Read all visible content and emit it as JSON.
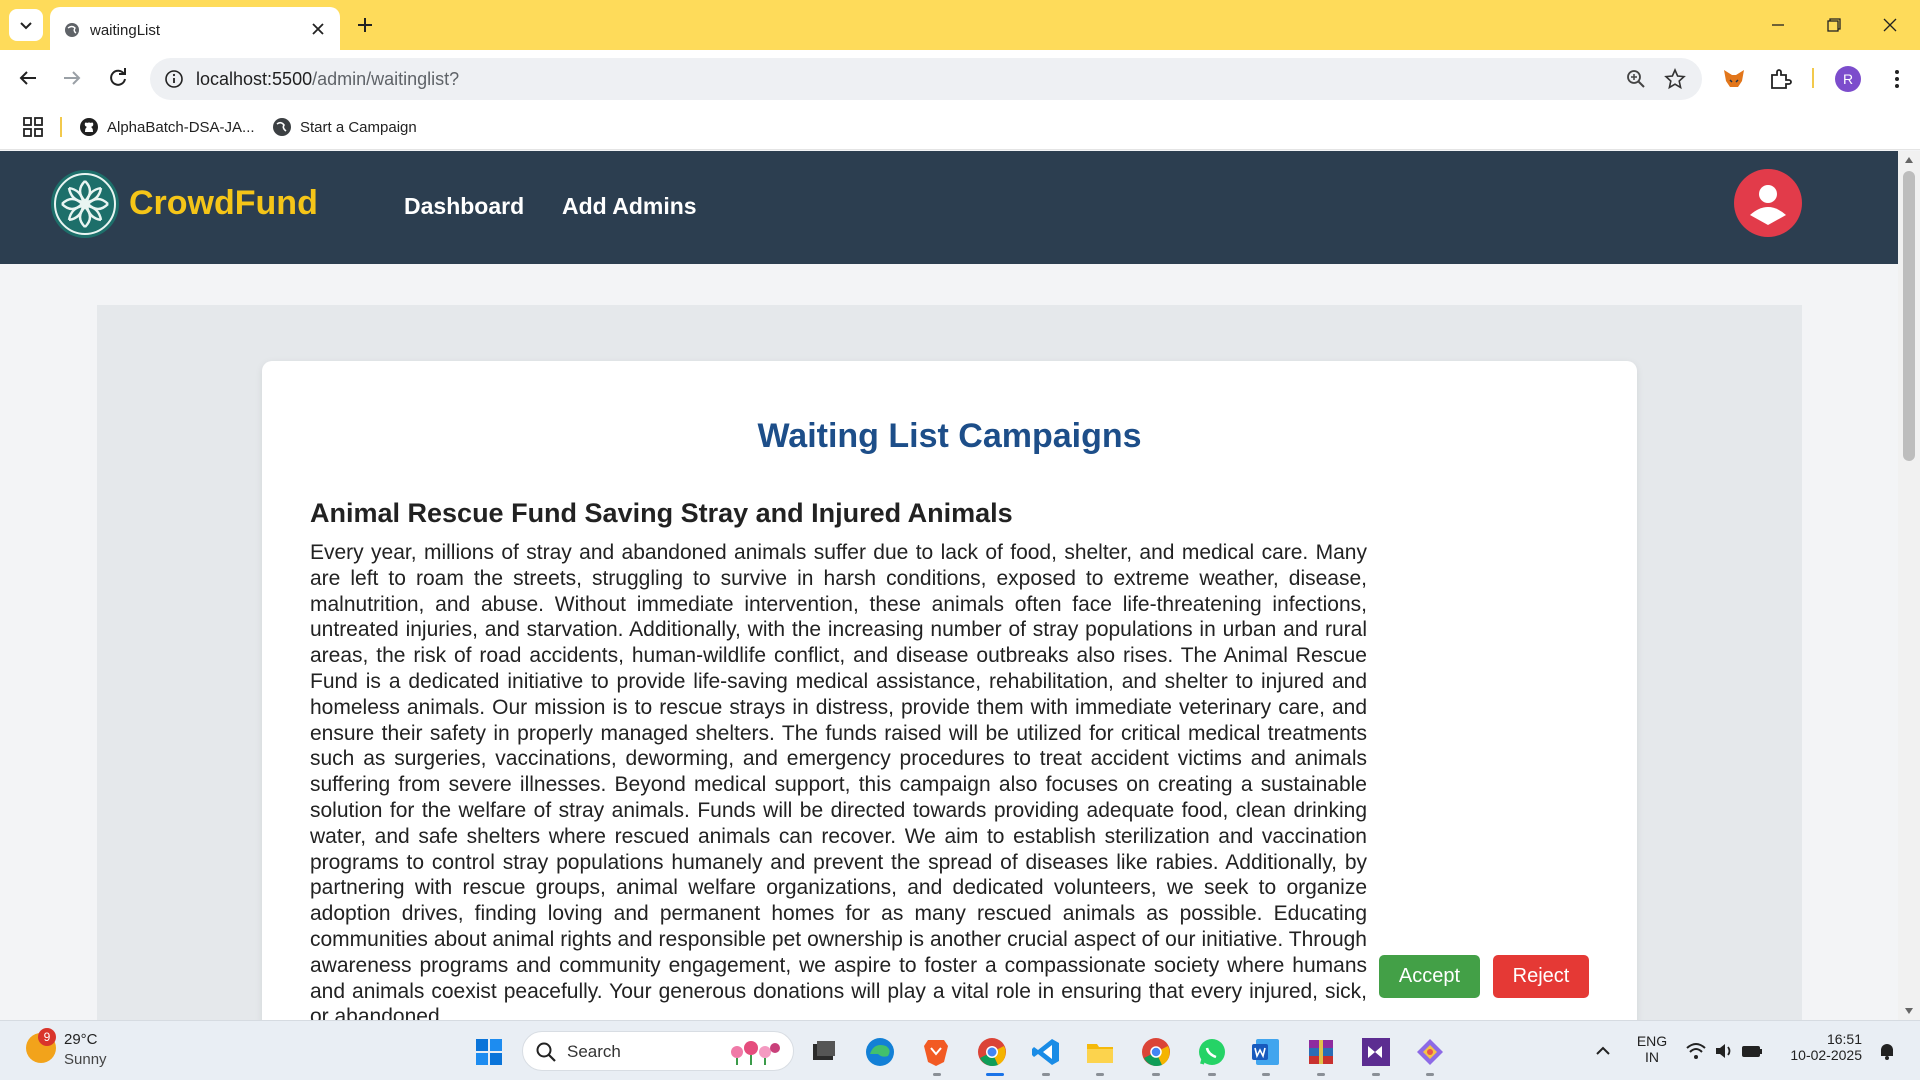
{
  "browser": {
    "tab_title": "waitingList",
    "url_host": "localhost:5500",
    "url_path": "/admin/waitinglist?",
    "profile_initial": "R",
    "bookmarks": [
      {
        "label": "AlphaBatch-DSA-JA..."
      },
      {
        "label": "Start a Campaign"
      }
    ]
  },
  "navbar": {
    "brand": "CrowdFund",
    "links": [
      {
        "label": "Dashboard"
      },
      {
        "label": "Add Admins"
      }
    ]
  },
  "main": {
    "heading": "Waiting List Campaigns",
    "campaign": {
      "title": "Animal Rescue Fund Saving Stray and Injured Animals",
      "description": "Every year, millions of stray and abandoned animals suffer due to lack of food, shelter, and medical care. Many are left to roam the streets, struggling to survive in harsh conditions, exposed to extreme weather, disease, malnutrition, and abuse. Without immediate intervention, these animals often face life-threatening infections, untreated injuries, and starvation. Additionally, with the increasing number of stray populations in urban and rural areas, the risk of road accidents, human-wildlife conflict, and disease outbreaks also rises. The Animal Rescue Fund is a dedicated initiative to provide life-saving medical assistance, rehabilitation, and shelter to injured and homeless animals. Our mission is to rescue strays in distress, provide them with immediate veterinary care, and ensure their safety in properly managed shelters. The funds raised will be utilized for critical medical treatments such as surgeries, vaccinations, deworming, and emergency procedures to treat accident victims and animals suffering from severe illnesses. Beyond medical support, this campaign also focuses on creating a sustainable solution for the welfare of stray animals. Funds will be directed towards providing adequate food, clean drinking water, and safe shelters where rescued animals can recover. We aim to establish sterilization and vaccination programs to control stray populations humanely and prevent the spread of diseases like rabies. Additionally, by partnering with rescue groups, animal welfare organizations, and dedicated volunteers, we seek to organize adoption drives, finding loving and permanent homes for as many rescued animals as possible. Educating communities about animal rights and responsible pet ownership is another crucial aspect of our initiative. Through awareness programs and community engagement, we aspire to foster a compassionate society where humans and animals coexist peacefully. Your generous donations will play a vital role in ensuring that every injured, sick, or abandoned",
      "accept_label": "Accept",
      "reject_label": "Reject"
    }
  },
  "taskbar": {
    "weather_badge": "9",
    "temperature": "29°C",
    "condition": "Sunny",
    "search_label": "Search",
    "lang_line1": "ENG",
    "lang_line2": "IN",
    "time": "16:51",
    "date": "10-02-2025"
  },
  "colors": {
    "tabbar": "#fedb5a",
    "navbar": "#2c3e50",
    "brand": "#f5c518",
    "heading": "#1d4e89",
    "accept": "#43a047",
    "reject": "#e53935",
    "avatar": "#e23b4a"
  }
}
